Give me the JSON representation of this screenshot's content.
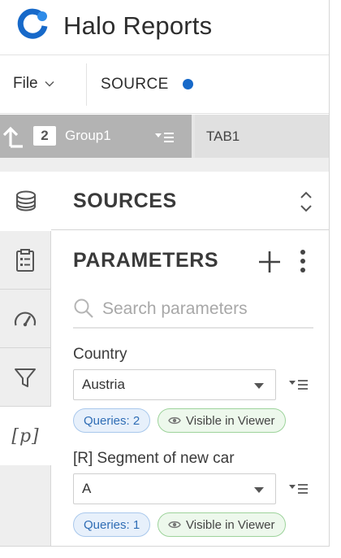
{
  "app": {
    "title": "Halo Reports",
    "brand_color": "#1769c9"
  },
  "menubar": {
    "file_label": "File",
    "source_label": "SOURCE",
    "source_status_color": "#1769c9"
  },
  "tabs": {
    "group": {
      "count": "2",
      "name": "Group1"
    },
    "tab1_label": "TAB1"
  },
  "rail": {
    "items": [
      {
        "icon": "database-icon"
      },
      {
        "icon": "clipboard-list-icon"
      },
      {
        "icon": "gauge-icon"
      },
      {
        "icon": "filter-icon"
      },
      {
        "icon": "parameter-icon",
        "text": "[p]"
      }
    ]
  },
  "sources": {
    "title": "SOURCES"
  },
  "parameters": {
    "title": "PARAMETERS",
    "search_placeholder": "Search parameters",
    "items": [
      {
        "label": "Country",
        "value": "Austria",
        "queries_badge": "Queries: 2",
        "visibility_badge": "Visible in Viewer"
      },
      {
        "label": "[R] Segment of new car",
        "value": "A",
        "queries_badge": "Queries: 1",
        "visibility_badge": "Visible in Viewer"
      }
    ]
  }
}
